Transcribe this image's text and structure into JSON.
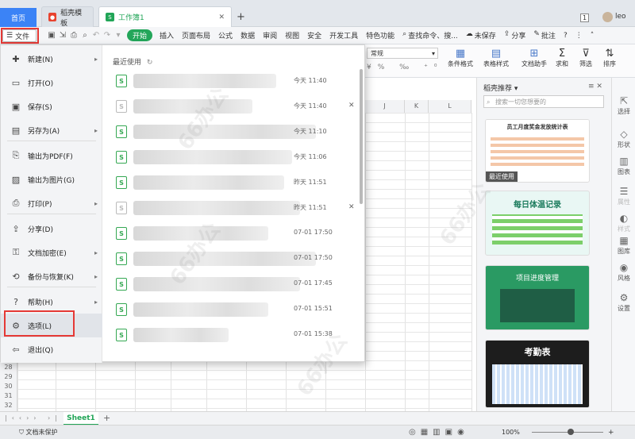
{
  "tabs": {
    "home": "首页",
    "docer": "稻壳模板",
    "workbook": "工作簿1",
    "add": "+",
    "page_count": "1",
    "user": "leo"
  },
  "menubar": {
    "file": "文件",
    "items": [
      "开始",
      "插入",
      "页面布局",
      "公式",
      "数据",
      "审阅",
      "视图",
      "安全",
      "开发工具",
      "特色功能"
    ],
    "active": "开始",
    "search": "查找命令、搜...",
    "unsaved": "未保存",
    "share": "分享",
    "comment": "批注",
    "help": "?"
  },
  "ribbon": {
    "format": "常规",
    "buttons": [
      "条件格式",
      "表格样式",
      "文档助手",
      "求和",
      "筛选",
      "排序"
    ]
  },
  "file_menu": {
    "items": [
      {
        "label": "新建(N)",
        "icon": "new-icon",
        "arrow": true
      },
      {
        "label": "打开(O)",
        "icon": "folder-icon",
        "arrow": false
      },
      {
        "label": "保存(S)",
        "icon": "save-icon",
        "arrow": false
      },
      {
        "label": "另存为(A)",
        "icon": "save-as-icon",
        "arrow": true
      },
      {
        "label": "输出为PDF(F)",
        "icon": "pdf-icon",
        "arrow": false
      },
      {
        "label": "输出为图片(G)",
        "icon": "image-icon",
        "arrow": false
      },
      {
        "label": "打印(P)",
        "icon": "print-icon",
        "arrow": true
      },
      {
        "label": "分享(D)",
        "icon": "share-icon",
        "arrow": false
      },
      {
        "label": "文档加密(E)",
        "icon": "lock-icon",
        "arrow": true
      },
      {
        "label": "备份与恢复(K)",
        "icon": "backup-icon",
        "arrow": true
      },
      {
        "label": "帮助(H)",
        "icon": "help-icon",
        "arrow": true
      },
      {
        "label": "选项(L)",
        "icon": "gear-icon",
        "arrow": false
      },
      {
        "label": "退出(Q)",
        "icon": "exit-icon",
        "arrow": false
      }
    ],
    "recent_title": "最近使用",
    "recent": [
      {
        "time": "今天 11:40",
        "x": false,
        "grey": false
      },
      {
        "time": "今天 11:40",
        "x": true,
        "grey": true
      },
      {
        "time": "今天 11:10",
        "x": false,
        "grey": false
      },
      {
        "time": "今天 11:06",
        "x": false,
        "grey": false
      },
      {
        "time": "昨天 11:51",
        "x": false,
        "grey": false
      },
      {
        "time": "昨天 11:51",
        "x": true,
        "grey": true
      },
      {
        "time": "07-01 17:50",
        "x": false,
        "grey": false
      },
      {
        "time": "07-01 17:50",
        "x": false,
        "grey": false
      },
      {
        "time": "07-01 17:45",
        "x": false,
        "grey": false
      },
      {
        "time": "07-01 15:51",
        "x": false,
        "grey": false
      },
      {
        "time": "07-01 15:38",
        "x": false,
        "grey": false
      }
    ]
  },
  "grid": {
    "columns": [
      "J",
      "K",
      "L"
    ],
    "rows": [
      "28",
      "29",
      "30",
      "31",
      "32",
      "33"
    ]
  },
  "right_panel": {
    "title": "稻壳推荐",
    "search_placeholder": "搜索一切您想要的",
    "templates": [
      {
        "title": "员工月度奖金发放统计表",
        "tag": "最近使用"
      },
      {
        "title": "每日体温记录"
      },
      {
        "title": "项目进度管理"
      },
      {
        "title": "考勤表"
      }
    ]
  },
  "right_side": [
    "选择",
    "形状",
    "图表",
    "属性",
    "样式",
    "图库",
    "风格",
    "设置"
  ],
  "sheet": {
    "name": "Sheet1",
    "add": "+"
  },
  "status": {
    "protect": "文档未保护",
    "zoom": "100%"
  }
}
